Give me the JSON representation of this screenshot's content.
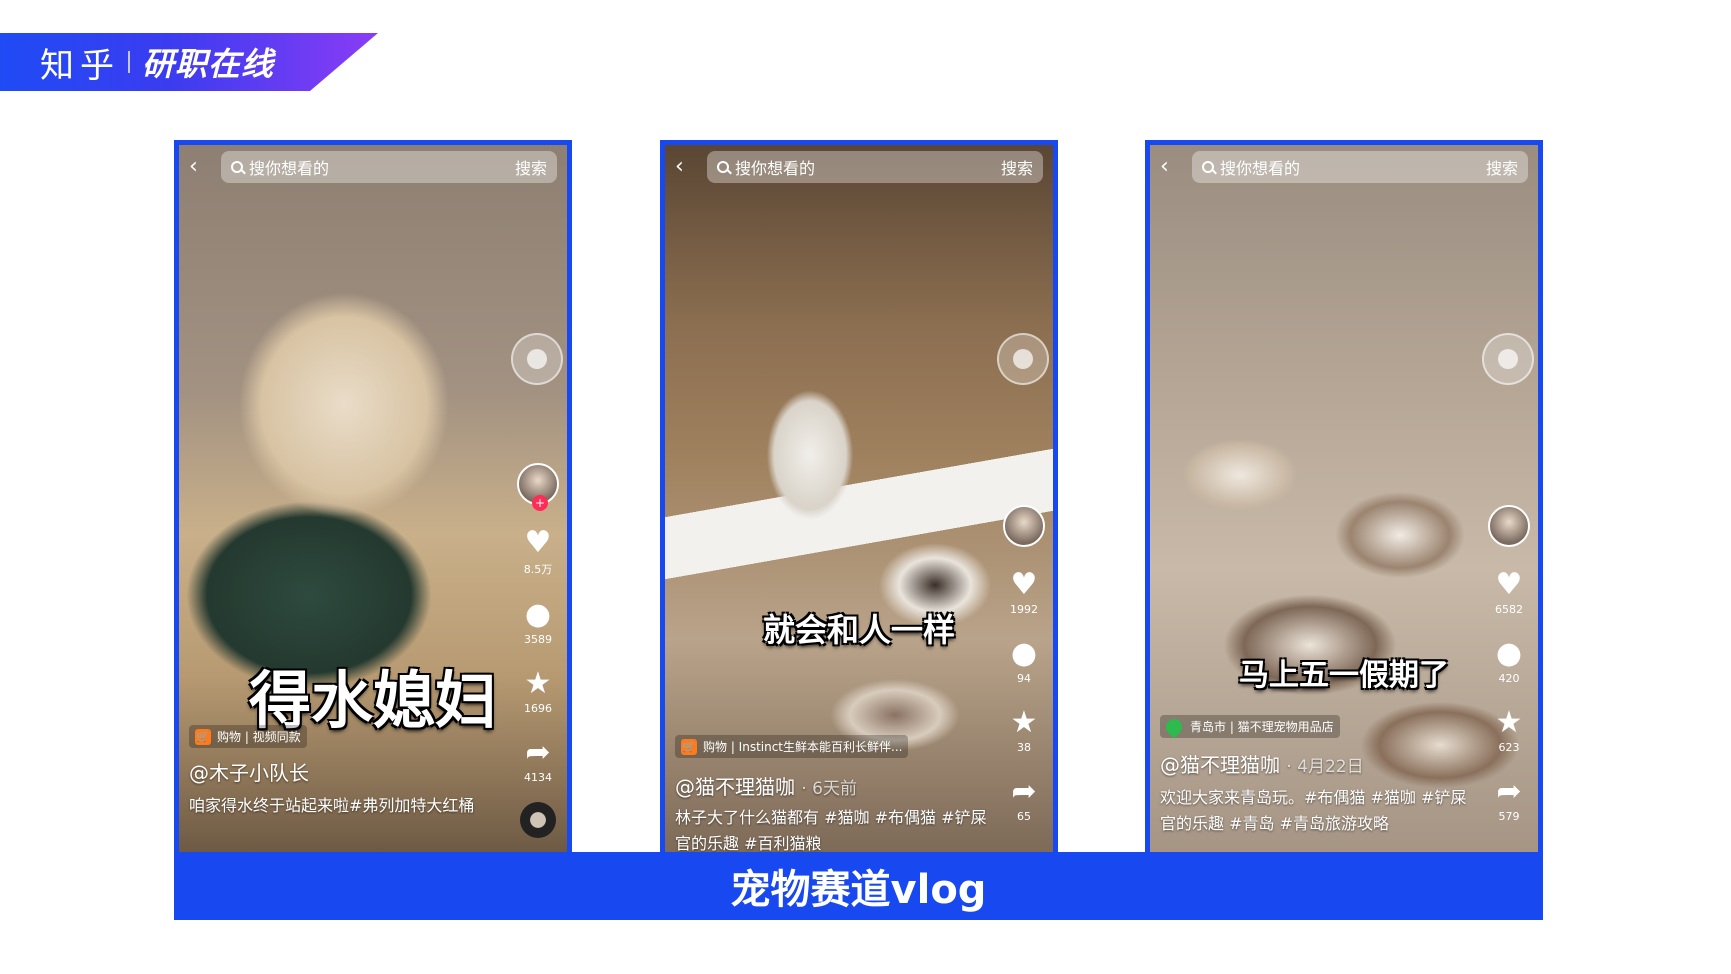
{
  "header": {
    "brand": "知乎",
    "slogan": "研职在线"
  },
  "caption": "宠物赛道vlog",
  "phones": [
    {
      "search_placeholder": "搜你想看的",
      "search_button": "搜索",
      "big_subtitle": "得水媳妇",
      "likes": "8.5万",
      "comments": "3589",
      "favorites": "1696",
      "shares": "4134",
      "shop_tag": "购物 | 视频同款",
      "author": "@木子小队长",
      "time": "",
      "description": "咱家得水终于站起来啦#弗列加特大红桶"
    },
    {
      "search_placeholder": "搜你想看的",
      "search_button": "搜索",
      "big_subtitle": "就会和人一样",
      "likes": "1992",
      "comments": "94",
      "favorites": "38",
      "shares": "65",
      "shop_tag": "购物 | Instinct生鲜本能百利长鲜伴...",
      "author": "@猫不理猫咖",
      "time": "· 6天前",
      "description": "林子大了什么猫都有 #猫咖 #布偶猫 #铲屎官的乐趣 #百利猫粮"
    },
    {
      "search_placeholder": "搜你想看的",
      "search_button": "搜索",
      "big_subtitle": "马上五一假期了",
      "likes": "6582",
      "comments": "420",
      "favorites": "623",
      "shares": "579",
      "shop_tag": "青岛市 | 猫不理宠物用品店",
      "author": "@猫不理猫咖",
      "time": "· 4月22日",
      "description": "欢迎大家来青岛玩。#布偶猫 #猫咖 #铲屎官的乐趣 #青岛 #青岛旅游攻略"
    }
  ],
  "colors": {
    "accent_blue": "#1848f0",
    "banner_end": "#8a3cf5"
  }
}
